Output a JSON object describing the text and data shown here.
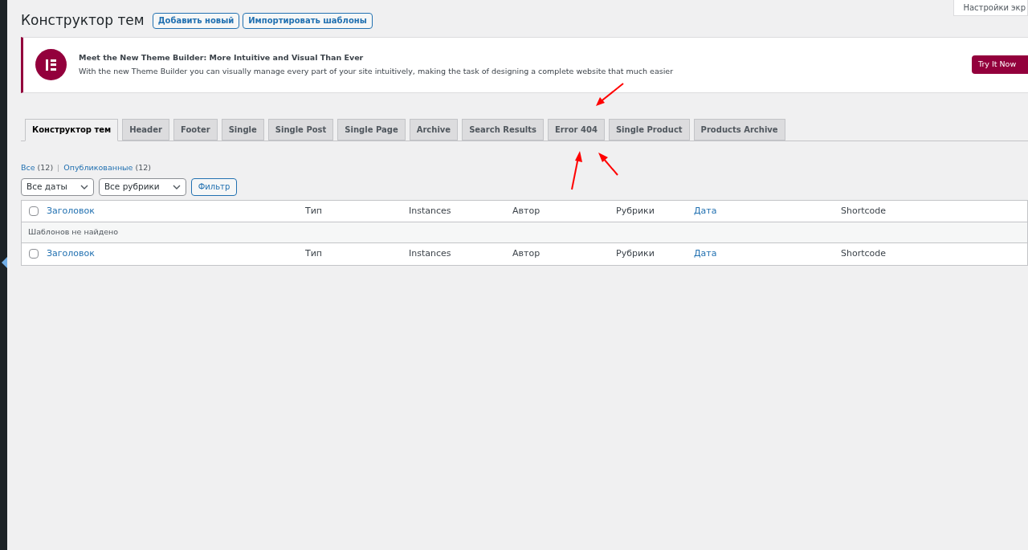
{
  "screen_options": "Настройки экр",
  "header": {
    "title": "Конструктор тем",
    "buttons": [
      "Добавить новый",
      "Импортировать шаблоны"
    ]
  },
  "notice": {
    "title": "Meet the New Theme Builder: More Intuitive and Visual Than Ever",
    "text": "With the new Theme Builder you can visually manage every part of your site intuitively, making the task of designing a complete website that much easier",
    "button": "Try It Now"
  },
  "tabs": [
    {
      "label": "Конструктор тем",
      "selected": true
    },
    {
      "label": "Header",
      "selected": false
    },
    {
      "label": "Footer",
      "selected": false
    },
    {
      "label": "Single",
      "selected": false
    },
    {
      "label": "Single Post",
      "selected": false
    },
    {
      "label": "Single Page",
      "selected": false
    },
    {
      "label": "Archive",
      "selected": false
    },
    {
      "label": "Search Results",
      "selected": false
    },
    {
      "label": "Error 404",
      "selected": false
    },
    {
      "label": "Single Product",
      "selected": false
    },
    {
      "label": "Products Archive",
      "selected": false
    }
  ],
  "views": [
    {
      "label": "Все",
      "count": "(12)"
    },
    {
      "separator": "|",
      "label": "Опубликованные",
      "count": "(12)"
    }
  ],
  "filters": {
    "selects": [
      "Все даты",
      "Все рубрики"
    ],
    "button": "Фильтр"
  },
  "table": {
    "header": {
      "checked": false,
      "columns": [
        {
          "label": "Заголовок",
          "sortable": true
        },
        {
          "label": "Тип",
          "sortable": false
        },
        {
          "label": "Instances",
          "sortable": false
        },
        {
          "label": "Автор",
          "sortable": false
        },
        {
          "label": "Рубрики",
          "sortable": false
        },
        {
          "label": "Дата",
          "sortable": true
        },
        {
          "label": "Shortcode",
          "sortable": false
        }
      ]
    },
    "empty": "Шаблонов не найдено",
    "footer": {
      "checked": false,
      "columns": [
        {
          "label": "Заголовок",
          "sortable": true
        },
        {
          "label": "Тип",
          "sortable": false
        },
        {
          "label": "Instances",
          "sortable": false
        },
        {
          "label": "Автор",
          "sortable": false
        },
        {
          "label": "Рубрики",
          "sortable": false
        },
        {
          "label": "Дата",
          "sortable": true
        },
        {
          "label": "Shortcode",
          "sortable": false
        }
      ]
    }
  }
}
